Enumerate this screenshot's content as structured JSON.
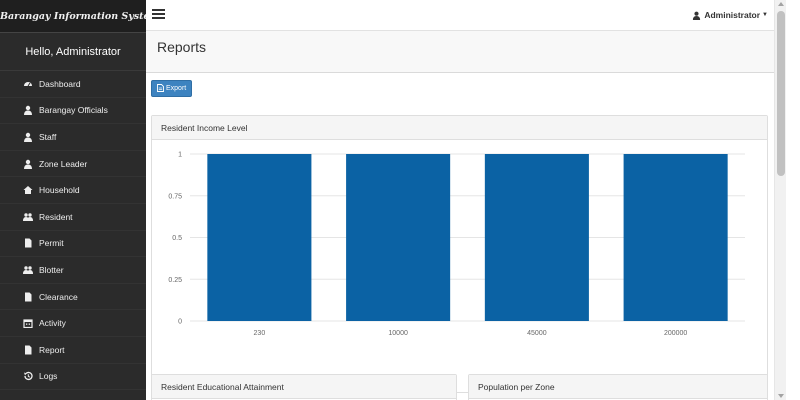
{
  "app": {
    "brand": "Barangay Information System",
    "greeting": "Hello, Administrator"
  },
  "sidebar": {
    "items": [
      {
        "label": "Dashboard",
        "icon": "dashboard-icon"
      },
      {
        "label": "Barangay Officials",
        "icon": "user-icon"
      },
      {
        "label": "Staff",
        "icon": "user-icon"
      },
      {
        "label": "Zone Leader",
        "icon": "user-icon"
      },
      {
        "label": "Household",
        "icon": "home-icon"
      },
      {
        "label": "Resident",
        "icon": "users-icon"
      },
      {
        "label": "Permit",
        "icon": "file-icon"
      },
      {
        "label": "Blotter",
        "icon": "users-icon"
      },
      {
        "label": "Clearance",
        "icon": "file-icon"
      },
      {
        "label": "Activity",
        "icon": "calendar-icon"
      },
      {
        "label": "Report",
        "icon": "file-icon"
      },
      {
        "label": "Logs",
        "icon": "history-icon"
      }
    ]
  },
  "header": {
    "user_label": "Administrator"
  },
  "page": {
    "title": "Reports",
    "export_label": "Export"
  },
  "panels": {
    "income_title": "Resident Income Level",
    "education_title": "Resident Educational Attainment",
    "zone_title": "Population per Zone"
  },
  "chart_data": {
    "type": "bar",
    "title": "",
    "categories": [
      "230",
      "10000",
      "45000",
      "200000"
    ],
    "values": [
      1,
      1,
      1,
      1
    ],
    "ylim": [
      0,
      1
    ],
    "yticks": [
      "0",
      "0.25",
      "0.5",
      "0.75",
      "1"
    ],
    "grid": true,
    "bar_color": "#0b62a4"
  },
  "colors": {
    "sidebar_bg": "#2b2b2b",
    "accent": "#3d83c0"
  }
}
